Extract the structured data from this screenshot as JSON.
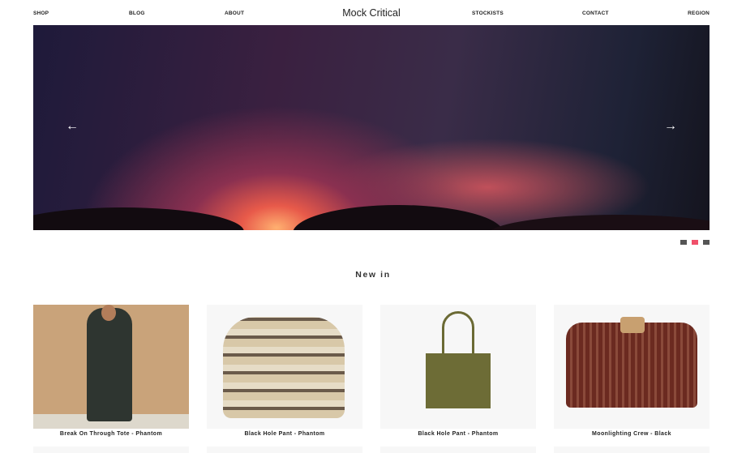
{
  "nav": {
    "left": [
      "SHOP",
      "BLOG",
      "ABOUT"
    ],
    "right": [
      "STOCKISTS",
      "CONTACT",
      "REGION"
    ],
    "logo": "Mock Critical"
  },
  "hero": {
    "prev_icon": "arrow-left-icon",
    "next_icon": "arrow-right-icon",
    "prev": "←",
    "next": "→",
    "slides": 3,
    "active_slide": 2
  },
  "colors": {
    "dot": "#555555",
    "dot_active": "#f0506a"
  },
  "section_title": "New in",
  "products": [
    {
      "title": "Break On Through Tote - Phantom"
    },
    {
      "title": "Black Hole Pant - Phantom"
    },
    {
      "title": "Black Hole Pant - Phantom"
    },
    {
      "title": "Moonlighting Crew - Black"
    }
  ]
}
